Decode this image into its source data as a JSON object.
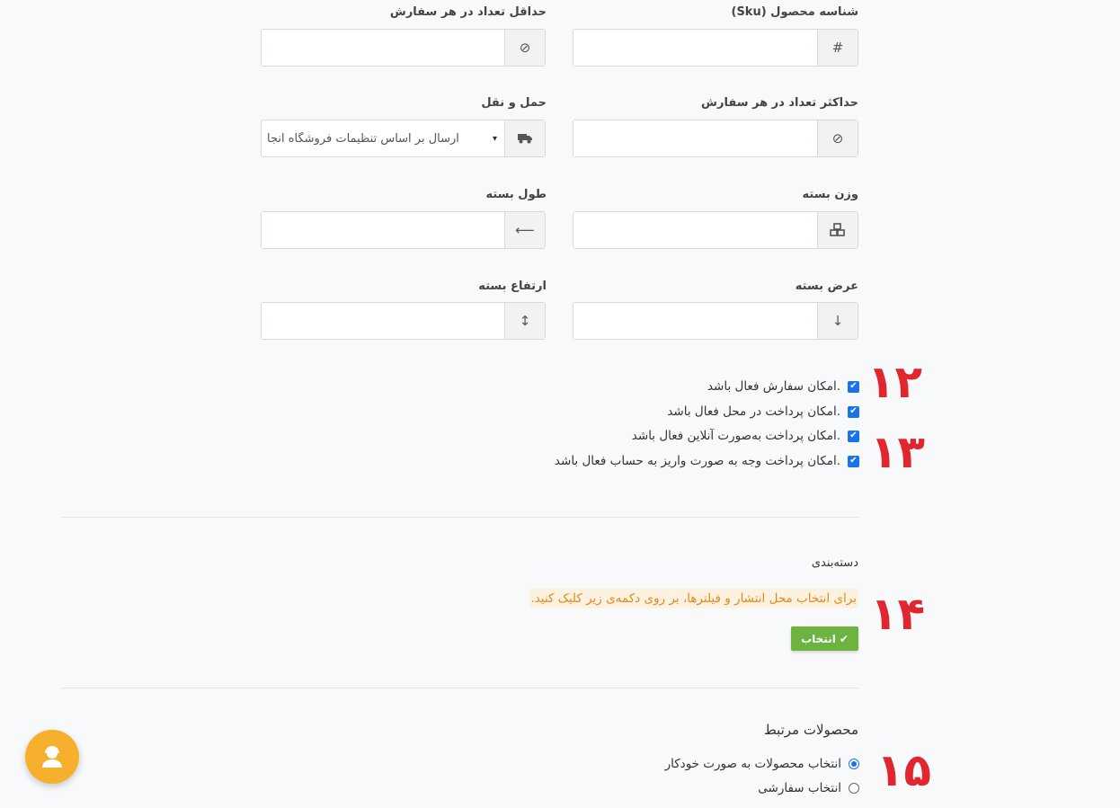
{
  "fields": {
    "sku": {
      "label": "شناسه محصول (Sku)",
      "icon": "hash-icon",
      "glyph": "#",
      "value": ""
    },
    "min_qty": {
      "label": "حداقل تعداد در هر سفارش",
      "icon": "ban-icon",
      "glyph": "⊘",
      "value": ""
    },
    "max_qty": {
      "label": "حداکثر تعداد در هر سفارش",
      "icon": "ban-icon",
      "glyph": "⊘",
      "value": ""
    },
    "shipping": {
      "label": "حمل و نقل",
      "icon": "truck-icon",
      "glyph": "🚚",
      "selected": "ارسال بر اساس تنظیمات فروشگاه انجا"
    },
    "weight": {
      "label": "وزن بسته",
      "icon": "cubes-icon",
      "glyph": "⧉",
      "value": ""
    },
    "length": {
      "label": "طول بسته",
      "icon": "arrow-left-icon",
      "glyph": "⟵",
      "value": ""
    },
    "width": {
      "label": "عرض بسته",
      "icon": "arrow-down-icon",
      "glyph": "↓",
      "value": ""
    },
    "height": {
      "label": "ارتفاع بسته",
      "icon": "arrow-vertical-icon",
      "glyph": "↕",
      "value": ""
    }
  },
  "options": [
    {
      "label": "امکان سفارش فعال باشد.",
      "checked": true
    },
    {
      "label": "امکان پرداخت در محل فعال باشد.",
      "checked": true
    },
    {
      "label": "امکان پرداخت به‌صورت آنلاین فعال باشد.",
      "checked": true
    },
    {
      "label": "امکان پرداخت وجه به صورت واریز به حساب فعال باشد.",
      "checked": true
    }
  ],
  "category": {
    "title": "دسته‌بندی",
    "hint": "برای انتخاب محل انتشار و فیلترها، بر روی دکمه‌ی زیر کلیک کنید.",
    "button_label": "انتخاب",
    "hint_color": "#e08a1e",
    "hint_bg": "#fdf1df",
    "button_color": "#6cb33f"
  },
  "related": {
    "title": "محصولات مرتبط",
    "choices": [
      {
        "label": "انتخاب محصولات به صورت خودکار",
        "selected": true
      },
      {
        "label": "انتخاب سفارشی",
        "selected": false
      }
    ]
  },
  "annotations": {
    "n12": "۱۲",
    "n13": "۱۳",
    "n14": "۱۴",
    "n15": "۱۵",
    "color": "#e0262f"
  },
  "support": {
    "icon": "support-user-icon",
    "color": "#f6b02e"
  }
}
